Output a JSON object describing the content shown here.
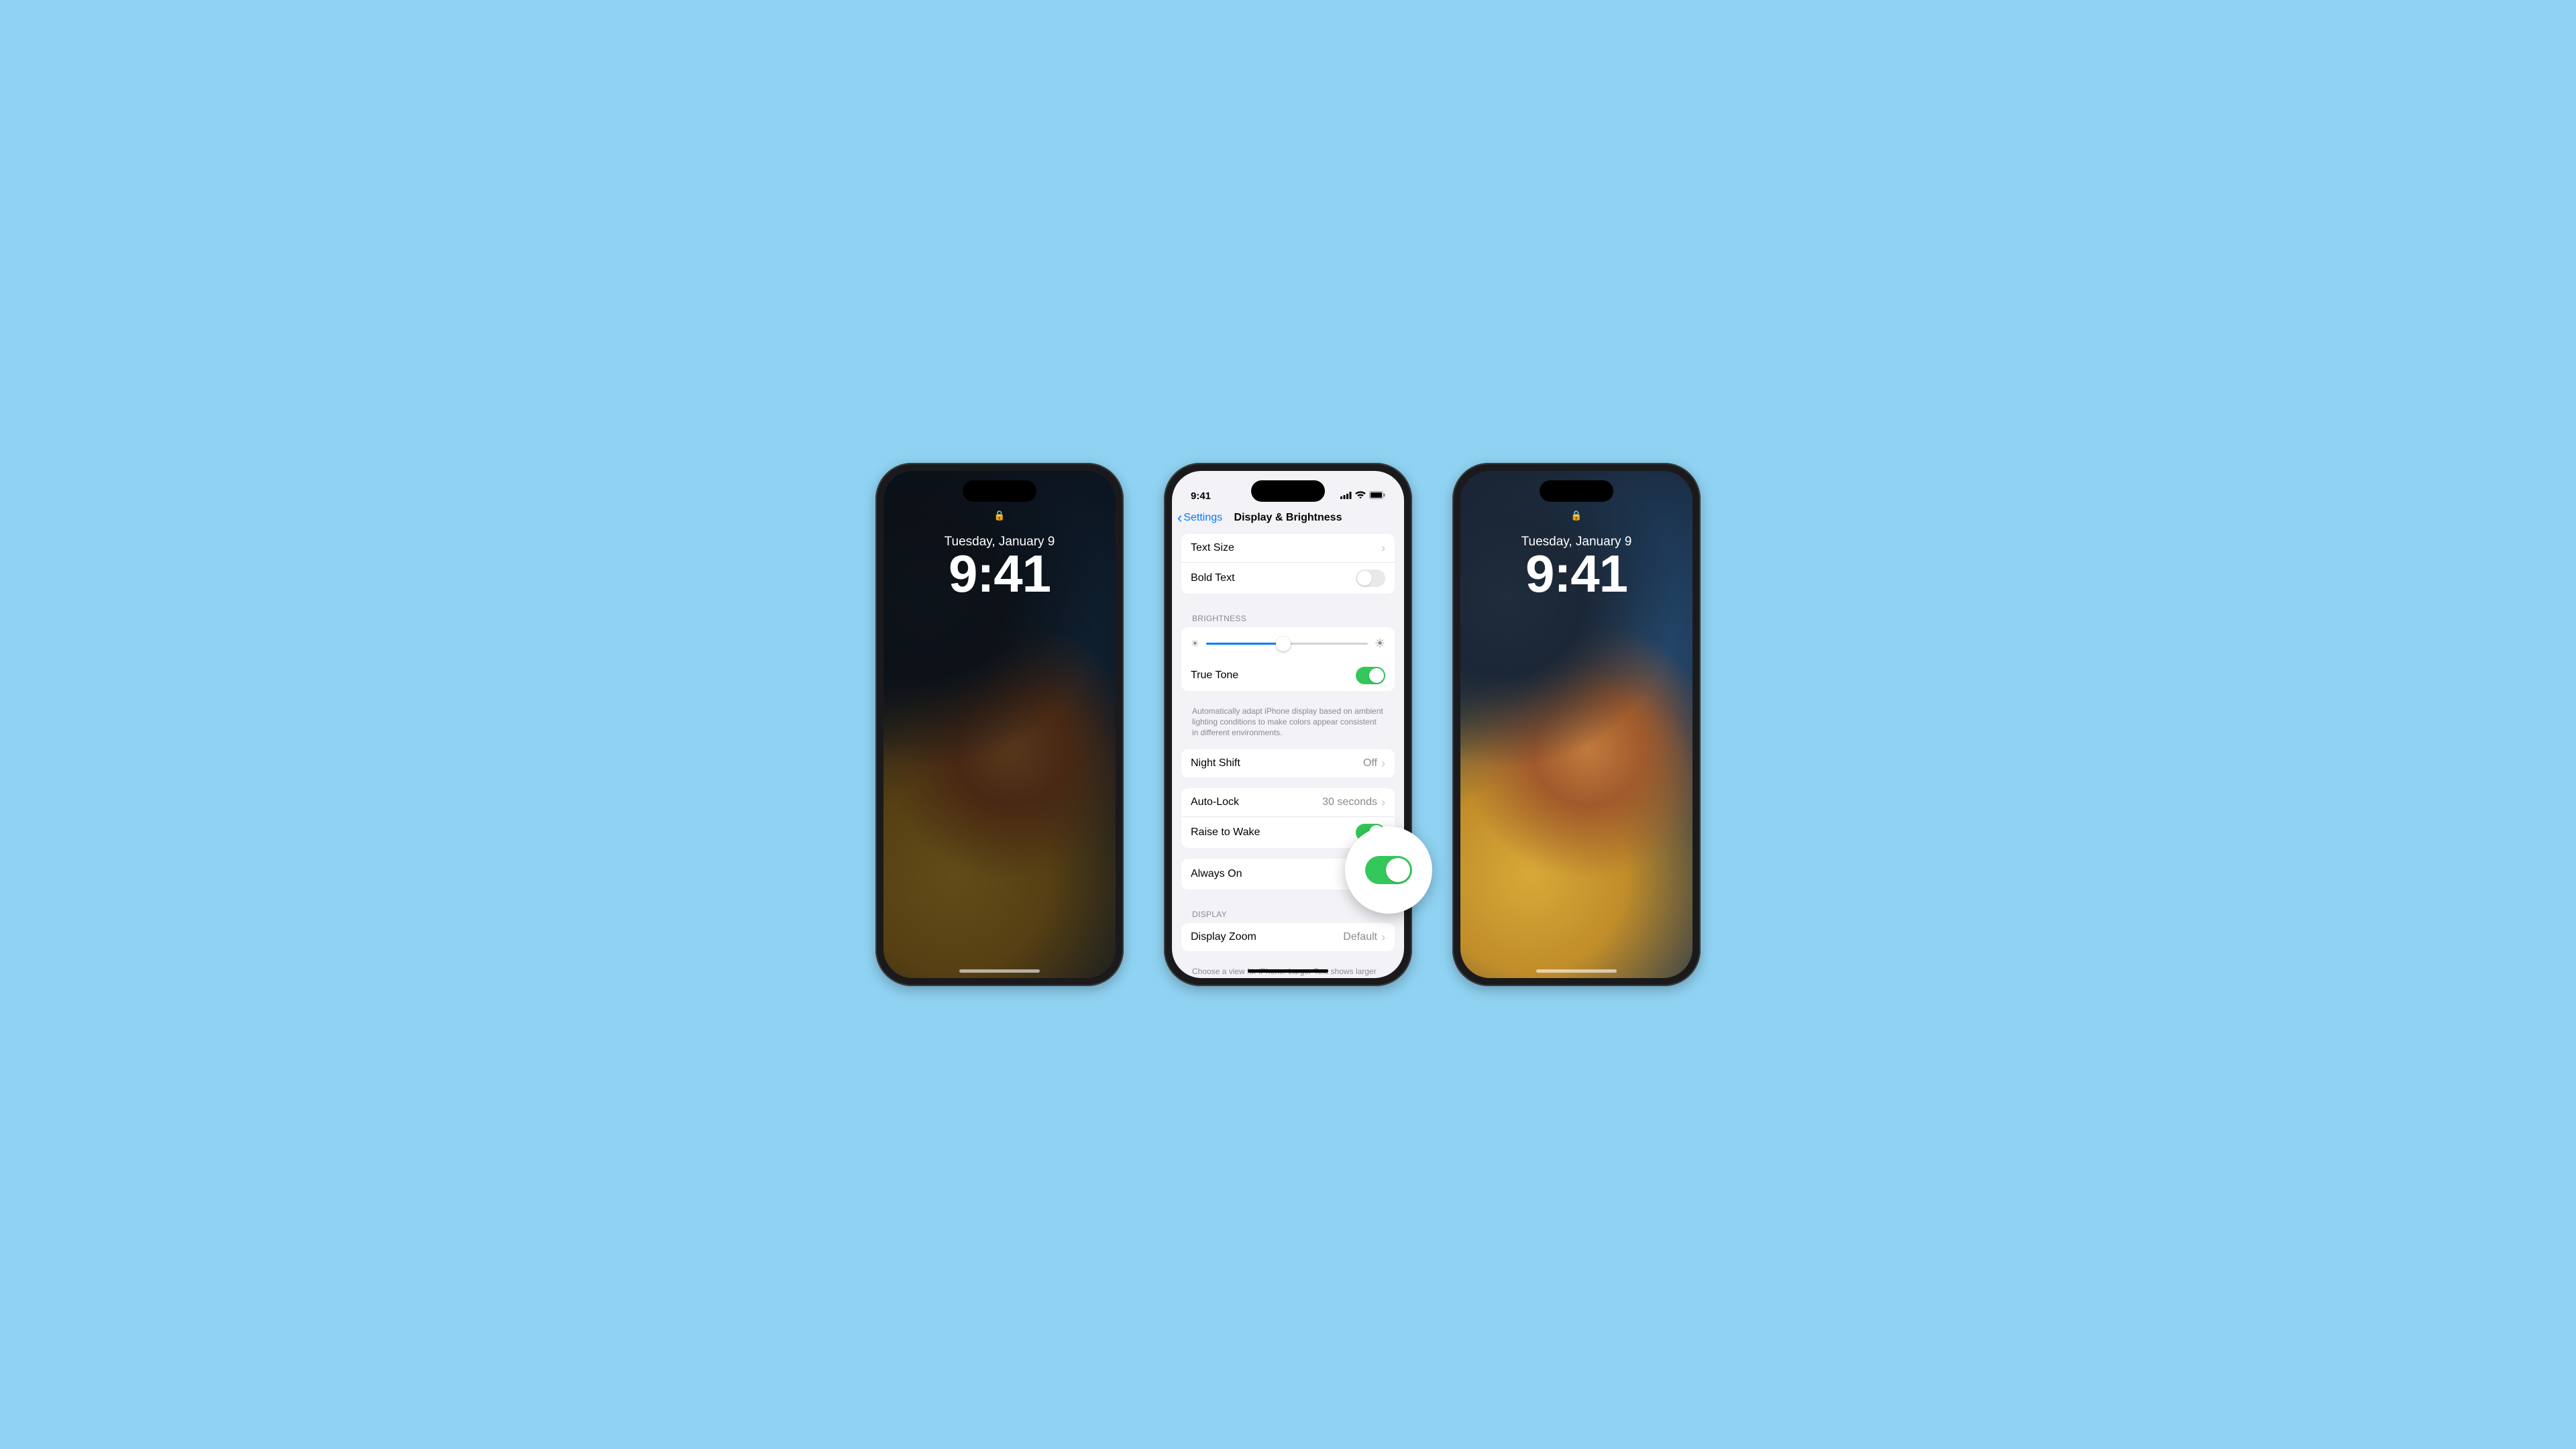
{
  "lock": {
    "date": "Tuesday, January 9",
    "time": "9:41"
  },
  "status": {
    "time": "9:41",
    "signal": "▮▮▮▮",
    "wifi": "wifi-icon",
    "battery": "battery-icon"
  },
  "nav": {
    "back_label": "Settings",
    "title": "Display & Brightness"
  },
  "rows": {
    "text_size": "Text Size",
    "bold_text": "Bold Text",
    "bold_text_on": false,
    "true_tone": "True Tone",
    "true_tone_on": true,
    "true_tone_footer": "Automatically adapt iPhone display based on ambient lighting conditions to make colors appear consistent in different environments.",
    "night_shift": "Night Shift",
    "night_shift_value": "Off",
    "auto_lock": "Auto-Lock",
    "auto_lock_value": "30 seconds",
    "raise_to_wake": "Raise to Wake",
    "raise_to_wake_on": true,
    "always_on": "Always On",
    "always_on_on": true,
    "display_zoom": "Display Zoom",
    "display_zoom_value": "Default",
    "display_zoom_footer": "Choose a view for iPhone. Larger Text shows larger controls. Default shows more content."
  },
  "headers": {
    "brightness": "BRIGHTNESS",
    "display": "DISPLAY"
  },
  "brightness_percent": 48
}
